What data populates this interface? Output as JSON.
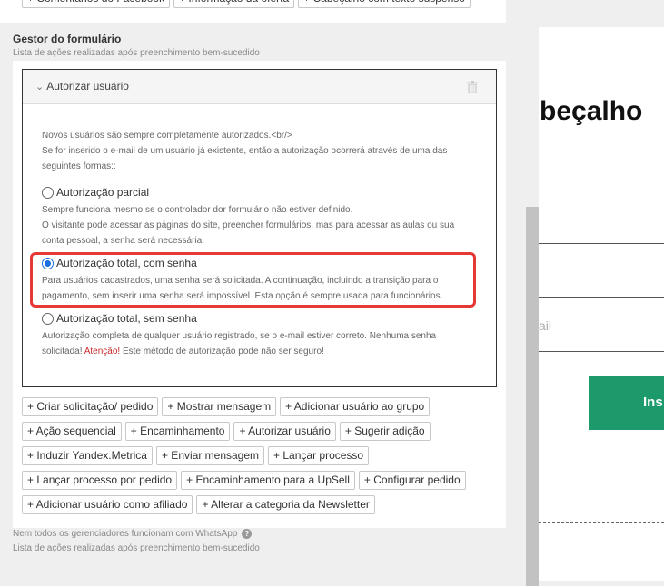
{
  "top_buttons": [
    "+ Comentários do Facebook",
    "+ Informação da oferta",
    "+ Cabeçalho com texto suspenso"
  ],
  "section": {
    "title": "Gestor do formulário",
    "subtitle": "Lista de ações realizadas após preenchimento bem-sucedido"
  },
  "action": {
    "title": "Autorizar usuário",
    "intro_line1": "Novos usuários são sempre completamente autorizados.<br/>",
    "intro_line2": "Se for inserido o e-mail de um usuário já existente, então a autorização ocorrerá através de uma das",
    "intro_line3": "seguintes formas::",
    "options": [
      {
        "label": "Autorização parcial",
        "selected": false,
        "desc1": "Sempre funciona mesmo se o controlador dor formulário não estiver definido.",
        "desc2": "O visitante pode acessar as páginas do site, preencher formulários, mas para acessar as aulas ou sua",
        "desc3": "conta pessoal, a senha será necessária."
      },
      {
        "label": "Autorização total, com senha",
        "selected": true,
        "desc1": "Para usuários cadastrados, uma senha será solicitada. A continuação, incluindo a transição para o",
        "desc2": "pagamento, sem inserir uma senha será impossível. Esta opção é sempre usada para funcionários."
      },
      {
        "label": "Autorização total, sem senha",
        "selected": false,
        "desc1": "Autorização completa de qualquer usuário registrado, se o e-mail estiver correto. Nenhuma senha",
        "desc2_start": "solicitada!",
        "desc2_warn": "Atenção!",
        "desc2_end": "Este método de autorização pode não ser seguro!"
      }
    ]
  },
  "add_buttons": [
    [
      "+ Criar solicitação/ pedido",
      "+ Mostrar mensagem",
      "+ Adicionar usuário ao grupo"
    ],
    [
      "+ Ação sequencial",
      "+ Encaminhamento",
      "+ Autorizar usuário",
      "+ Sugerir adição"
    ],
    [
      "+ Induzir Yandex.Metrica",
      "+ Enviar mensagem",
      "+ Lançar processo"
    ],
    [
      "+ Lançar processo por pedido",
      "+ Encaminhamento para a UpSell",
      "+ Configurar pedido"
    ],
    [
      "+ Adicionar usuário como afiliado",
      "+ Alterar a categoria da Newsletter"
    ]
  ],
  "footer": {
    "note": "Nem todos os gerenciadores funcionam com WhatsApp",
    "help_icon": "?",
    "subtitle": "Lista de ações realizadas após preenchimento bem-sucedido"
  },
  "preview": {
    "heading": "beçalho",
    "mail_placeholder": "ail",
    "button_label": "Ins"
  },
  "colors": {
    "highlight": "#e53935",
    "radio_selected": "#1a6fe0",
    "preview_button": "#1d9a6c",
    "warning_text": "#c62828"
  }
}
